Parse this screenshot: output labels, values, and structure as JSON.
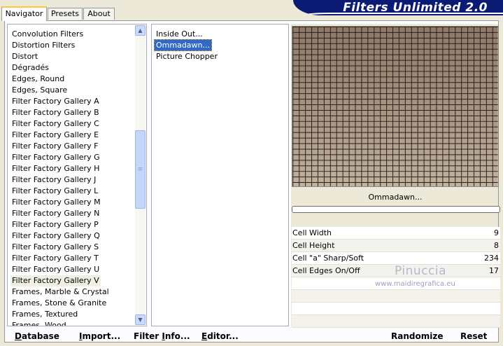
{
  "tabs": [
    {
      "label": "Navigator",
      "active": true
    },
    {
      "label": "Presets",
      "active": false
    },
    {
      "label": "About",
      "active": false
    }
  ],
  "banner": {
    "title": "Filters Unlimited 2.0"
  },
  "categories": [
    "Convolution Filters",
    "Distortion Filters",
    "Distort",
    "Dégradés",
    "Edges, Round",
    "Edges, Square",
    "Filter Factory Gallery A",
    "Filter Factory Gallery B",
    "Filter Factory Gallery C",
    "Filter Factory Gallery E",
    "Filter Factory Gallery F",
    "Filter Factory Gallery G",
    "Filter Factory Gallery H",
    "Filter Factory Gallery J",
    "Filter Factory Gallery L",
    "Filter Factory Gallery M",
    "Filter Factory Gallery N",
    "Filter Factory Gallery P",
    "Filter Factory Gallery Q",
    "Filter Factory Gallery S",
    "Filter Factory Gallery T",
    "Filter Factory Gallery U",
    "Filter Factory Gallery V",
    "Frames, Marble & Crystal",
    "Frames, Stone & Granite",
    "Frames, Textured",
    "Frames, Wood"
  ],
  "selected_category": "Filter Factory Gallery V",
  "filters": [
    "Inside Out...",
    "Ommadawn...",
    "Picture Chopper"
  ],
  "selected_filter": "Ommadawn...",
  "preview": {
    "name": "Ommadawn...",
    "progress": 0
  },
  "params": [
    {
      "name": "Cell Width",
      "value": "9"
    },
    {
      "name": "Cell Height",
      "value": "8"
    },
    {
      "name": "Cell \"a\" Sharp/Soft",
      "value": "234"
    },
    {
      "name": "Cell Edges On/Off",
      "value": "17"
    }
  ],
  "watermark": {
    "name": "Pinuccia",
    "url": "www.maidiregrafica.eu"
  },
  "buttons": {
    "database": {
      "first": "D",
      "rest": "atabase"
    },
    "import": {
      "first": "I",
      "rest": "mport..."
    },
    "filter_info": {
      "first": "Filter ",
      "u": "I",
      "rest": "nfo..."
    },
    "editor": {
      "first": "E",
      "rest": "ditor..."
    },
    "randomize": "Randomize",
    "reset": "Reset"
  },
  "colors": {
    "preview_bg": "#a08c7a",
    "grid_line": "#2a1f17",
    "selection": "#316ac5"
  }
}
